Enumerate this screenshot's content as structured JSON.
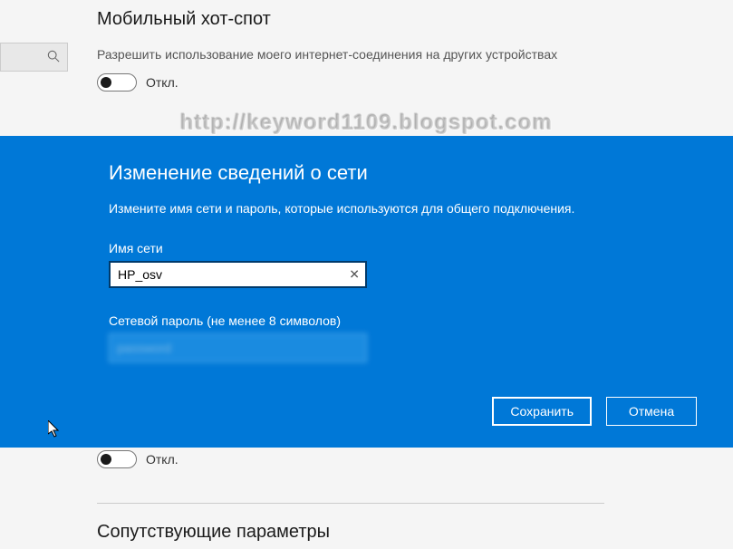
{
  "hotspot": {
    "title": "Мобильный хот-спот",
    "description": "Разрешить использование моего интернет-соединения на других устройствах",
    "toggle_label": "Откл."
  },
  "watermark": "http://keyword1109.blogspot.com",
  "modal": {
    "title": "Изменение сведений о сети",
    "description": "Измените имя сети и пароль, которые используются для общего подключения.",
    "network_name_label": "Имя сети",
    "network_name_value": "HP_osv",
    "password_label": "Сетевой пароль (не менее 8 символов)",
    "password_value": "password",
    "save_label": "Сохранить",
    "cancel_label": "Отмена"
  },
  "bottom": {
    "toggle_label": "Откл.",
    "related_title": "Сопутствующие параметры"
  }
}
